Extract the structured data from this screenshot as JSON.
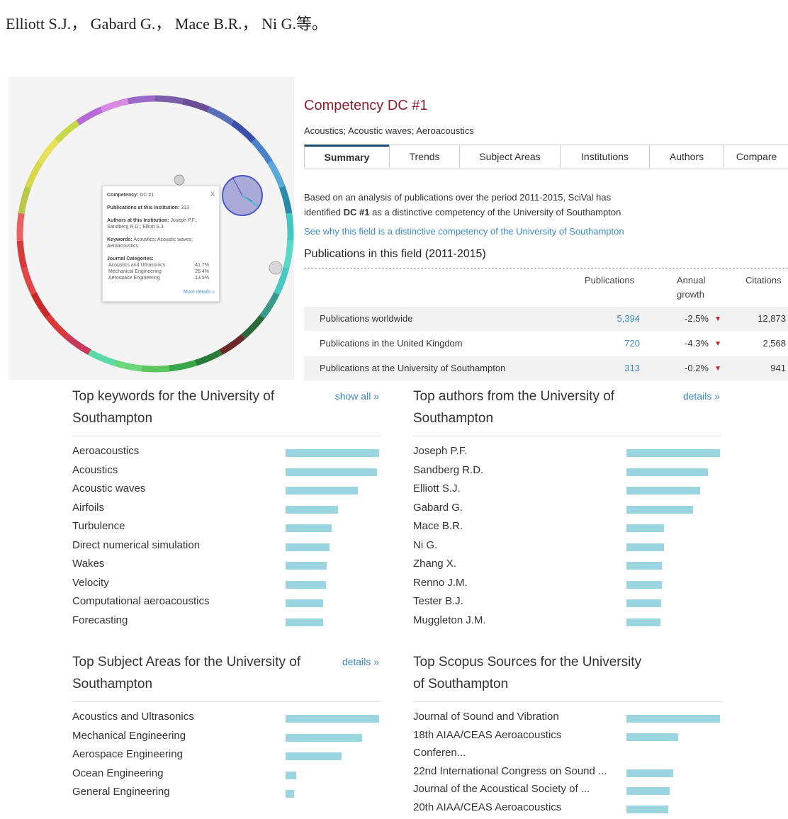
{
  "header_line": "Elliott S.J.， Gabard G.， Mace B.R.， Ni G.等。",
  "popup": {
    "competency_label": "Competency:",
    "competency_value": "DC #1",
    "close": "X",
    "publications_label": "Publications at this Institution:",
    "publications_value": "313",
    "authors_label": "Authors at this Institution:",
    "authors_value": "Joseph P.F.; Sandberg R.D.; Elliott S.J.",
    "keywords_label": "Keywords:",
    "keywords_value": "Acoustics; Acoustic waves; Aeroacoustics",
    "journal_label": "Journal Categories:",
    "journal_rows": [
      {
        "name": "Acoustics and Ultrasonics",
        "pct": "41.7%"
      },
      {
        "name": "Mechanical Engineering",
        "pct": "26.4%"
      },
      {
        "name": "Aerospace Engineering",
        "pct": "13.5%"
      }
    ],
    "more": "More details »"
  },
  "panel": {
    "title": "Competency DC #1",
    "subtitle": "Acoustics; Acoustic waves; Aeroacoustics",
    "tabs": [
      "Summary",
      "Trends",
      "Subject Areas",
      "Institutions",
      "Authors",
      "Compare"
    ],
    "active_tab": "Summary",
    "para_a": "Based on an analysis of publications over the period 2011-2015, SciVal has",
    "para_b_pre": "identified ",
    "para_b_bold": "DC #1",
    "para_b_post": " as a distinctive competency of the University of Southampton",
    "link": "See why this field is a distinctive competency of the University of Southampton",
    "pub_title": "Publications in this field (2011-2015)",
    "col_publications": "Publications",
    "col_growth_a": "Annual",
    "col_growth_b": "growth",
    "col_citations": "Citations",
    "rows": [
      {
        "label": "Publications worldwide",
        "pubs": "5,394",
        "growth": "-2.5%",
        "tri": "▼",
        "cit": "12,873"
      },
      {
        "label": "Publications in the United Kingdom",
        "pubs": "720",
        "growth": "-4.3%",
        "tri": "▼",
        "cit": "2,568"
      },
      {
        "label": "Publications at the University of Southampton",
        "pubs": "313",
        "growth": "-0.2%",
        "tri": "▼",
        "cit": "941"
      }
    ]
  },
  "keywords": {
    "title_a": "Top keywords for the University of",
    "title_b": "Southampton",
    "more": "show all »",
    "items": [
      {
        "label": "Aeroacoustics",
        "value": 1.0
      },
      {
        "label": "Acoustics",
        "value": 0.98
      },
      {
        "label": "Acoustic waves",
        "value": 0.77
      },
      {
        "label": "Airfoils",
        "value": 0.56
      },
      {
        "label": "Turbulence",
        "value": 0.49
      },
      {
        "label": "Direct numerical simulation",
        "value": 0.47
      },
      {
        "label": "Wakes",
        "value": 0.44
      },
      {
        "label": "Velocity",
        "value": 0.43
      },
      {
        "label": "Computational aeroacoustics",
        "value": 0.4
      },
      {
        "label": "Forecasting",
        "value": 0.4
      }
    ]
  },
  "authors": {
    "title_a": "Top authors from the University of",
    "title_b": "Southampton",
    "more": "details »",
    "items": [
      {
        "label": "Joseph P.F.",
        "value": 1.0
      },
      {
        "label": "Sandberg R.D.",
        "value": 0.87
      },
      {
        "label": "Elliott S.J.",
        "value": 0.79
      },
      {
        "label": "Gabard G.",
        "value": 0.71
      },
      {
        "label": "Mace B.R.",
        "value": 0.4
      },
      {
        "label": "Ni G.",
        "value": 0.4
      },
      {
        "label": "Zhang X.",
        "value": 0.38
      },
      {
        "label": "Renno J.M.",
        "value": 0.38
      },
      {
        "label": "Tester B.J.",
        "value": 0.37
      },
      {
        "label": "Muggleton J.M.",
        "value": 0.36
      }
    ]
  },
  "subjects": {
    "title_a": "Top Subject Areas for the University of",
    "title_b": "Southampton",
    "more": "details »",
    "items": [
      {
        "label": "Acoustics and Ultrasonics",
        "value": 1.0
      },
      {
        "label": "Mechanical Engineering",
        "value": 0.82
      },
      {
        "label": "Aerospace Engineering",
        "value": 0.6
      },
      {
        "label": "Ocean Engineering",
        "value": 0.11
      },
      {
        "label": "General Engineering",
        "value": 0.09
      }
    ]
  },
  "sources": {
    "title_a": "Top Scopus Sources for the University",
    "title_b": "of Southampton",
    "items": [
      {
        "label": "Journal of Sound and Vibration",
        "label2": "",
        "value": 1.0
      },
      {
        "label": "18th AIAA/CEAS Aeroacoustics",
        "label2": "Conferen...",
        "value": 0.55
      },
      {
        "label": "22nd International Congress on Sound ...",
        "label2": "",
        "value": 0.5
      },
      {
        "label": "Journal of the Acoustical Society of ...",
        "label2": "",
        "value": 0.46
      },
      {
        "label": "20th AIAA/CEAS Aeroacoustics",
        "label2": "",
        "value": 0.45
      }
    ]
  },
  "colors": {
    "bar": "#9ad5e0",
    "brand": "#8b2131",
    "link": "#3c89c5",
    "decline": "#cc2222"
  }
}
